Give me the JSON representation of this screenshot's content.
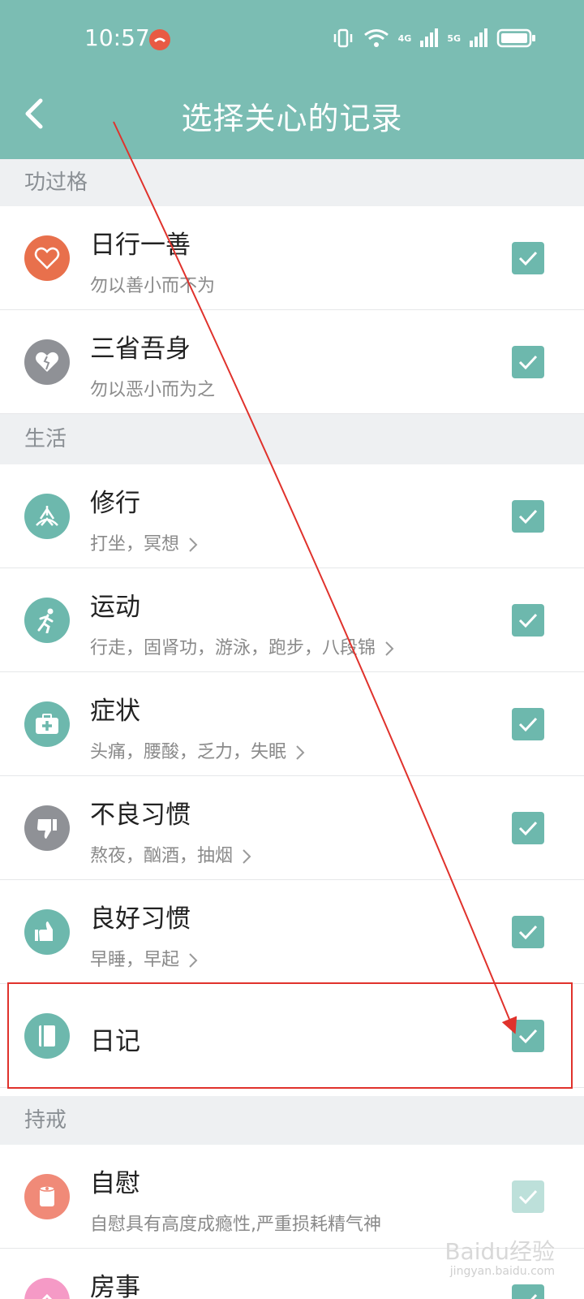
{
  "status": {
    "time": "10:57",
    "net1": "4G",
    "net2": "5G"
  },
  "header": {
    "title": "选择关心的记录"
  },
  "sections": [
    {
      "title": "功过格"
    },
    {
      "title": "生活"
    },
    {
      "title": "持戒"
    }
  ],
  "rows": [
    {
      "title": "日行一善",
      "subtitle": "勿以善小而不为",
      "icon": "heart-icon",
      "icon_color": "#e8704c",
      "checked": true
    },
    {
      "title": "三省吾身",
      "subtitle": "勿以恶小而为之",
      "icon": "broken-heart-icon",
      "icon_color": "#8f9196",
      "checked": true
    },
    {
      "title": "修行",
      "subtitle": "打坐，冥想",
      "icon": "meditation-icon",
      "icon_color": "#6db8ad",
      "checked": true
    },
    {
      "title": "运动",
      "subtitle": "行走，固肾功，游泳，跑步，八段锦",
      "icon": "running-icon",
      "icon_color": "#6db8ad",
      "checked": true
    },
    {
      "title": "症状",
      "subtitle": "头痛，腰酸，乏力，失眠",
      "icon": "medical-kit-icon",
      "icon_color": "#6db8ad",
      "checked": true
    },
    {
      "title": "不良习惯",
      "subtitle": "熬夜，酗酒，抽烟",
      "icon": "thumbs-down-icon",
      "icon_color": "#8f9196",
      "checked": true
    },
    {
      "title": "良好习惯",
      "subtitle": "早睡，早起",
      "icon": "thumbs-up-icon",
      "icon_color": "#6db8ad",
      "checked": true
    },
    {
      "title": "日记",
      "icon": "diary-icon",
      "icon_color": "#6db8ad",
      "checked": true
    },
    {
      "title": "自慰",
      "subtitle": "自慰具有高度成瘾性,严重损耗精气神",
      "icon": "tissue-roll-icon",
      "icon_color": "#f08a78",
      "checked": true
    },
    {
      "title": "房事",
      "icon": "pink-icon",
      "icon_color": "#f59ac6",
      "checked": true
    }
  ],
  "watermark": {
    "brand": "Baidu经验",
    "url": "jingyan.baidu.com"
  },
  "colors": {
    "accent": "#7bbdb3",
    "checkbox": "#6db8ad",
    "annotation": "#e0322c"
  }
}
